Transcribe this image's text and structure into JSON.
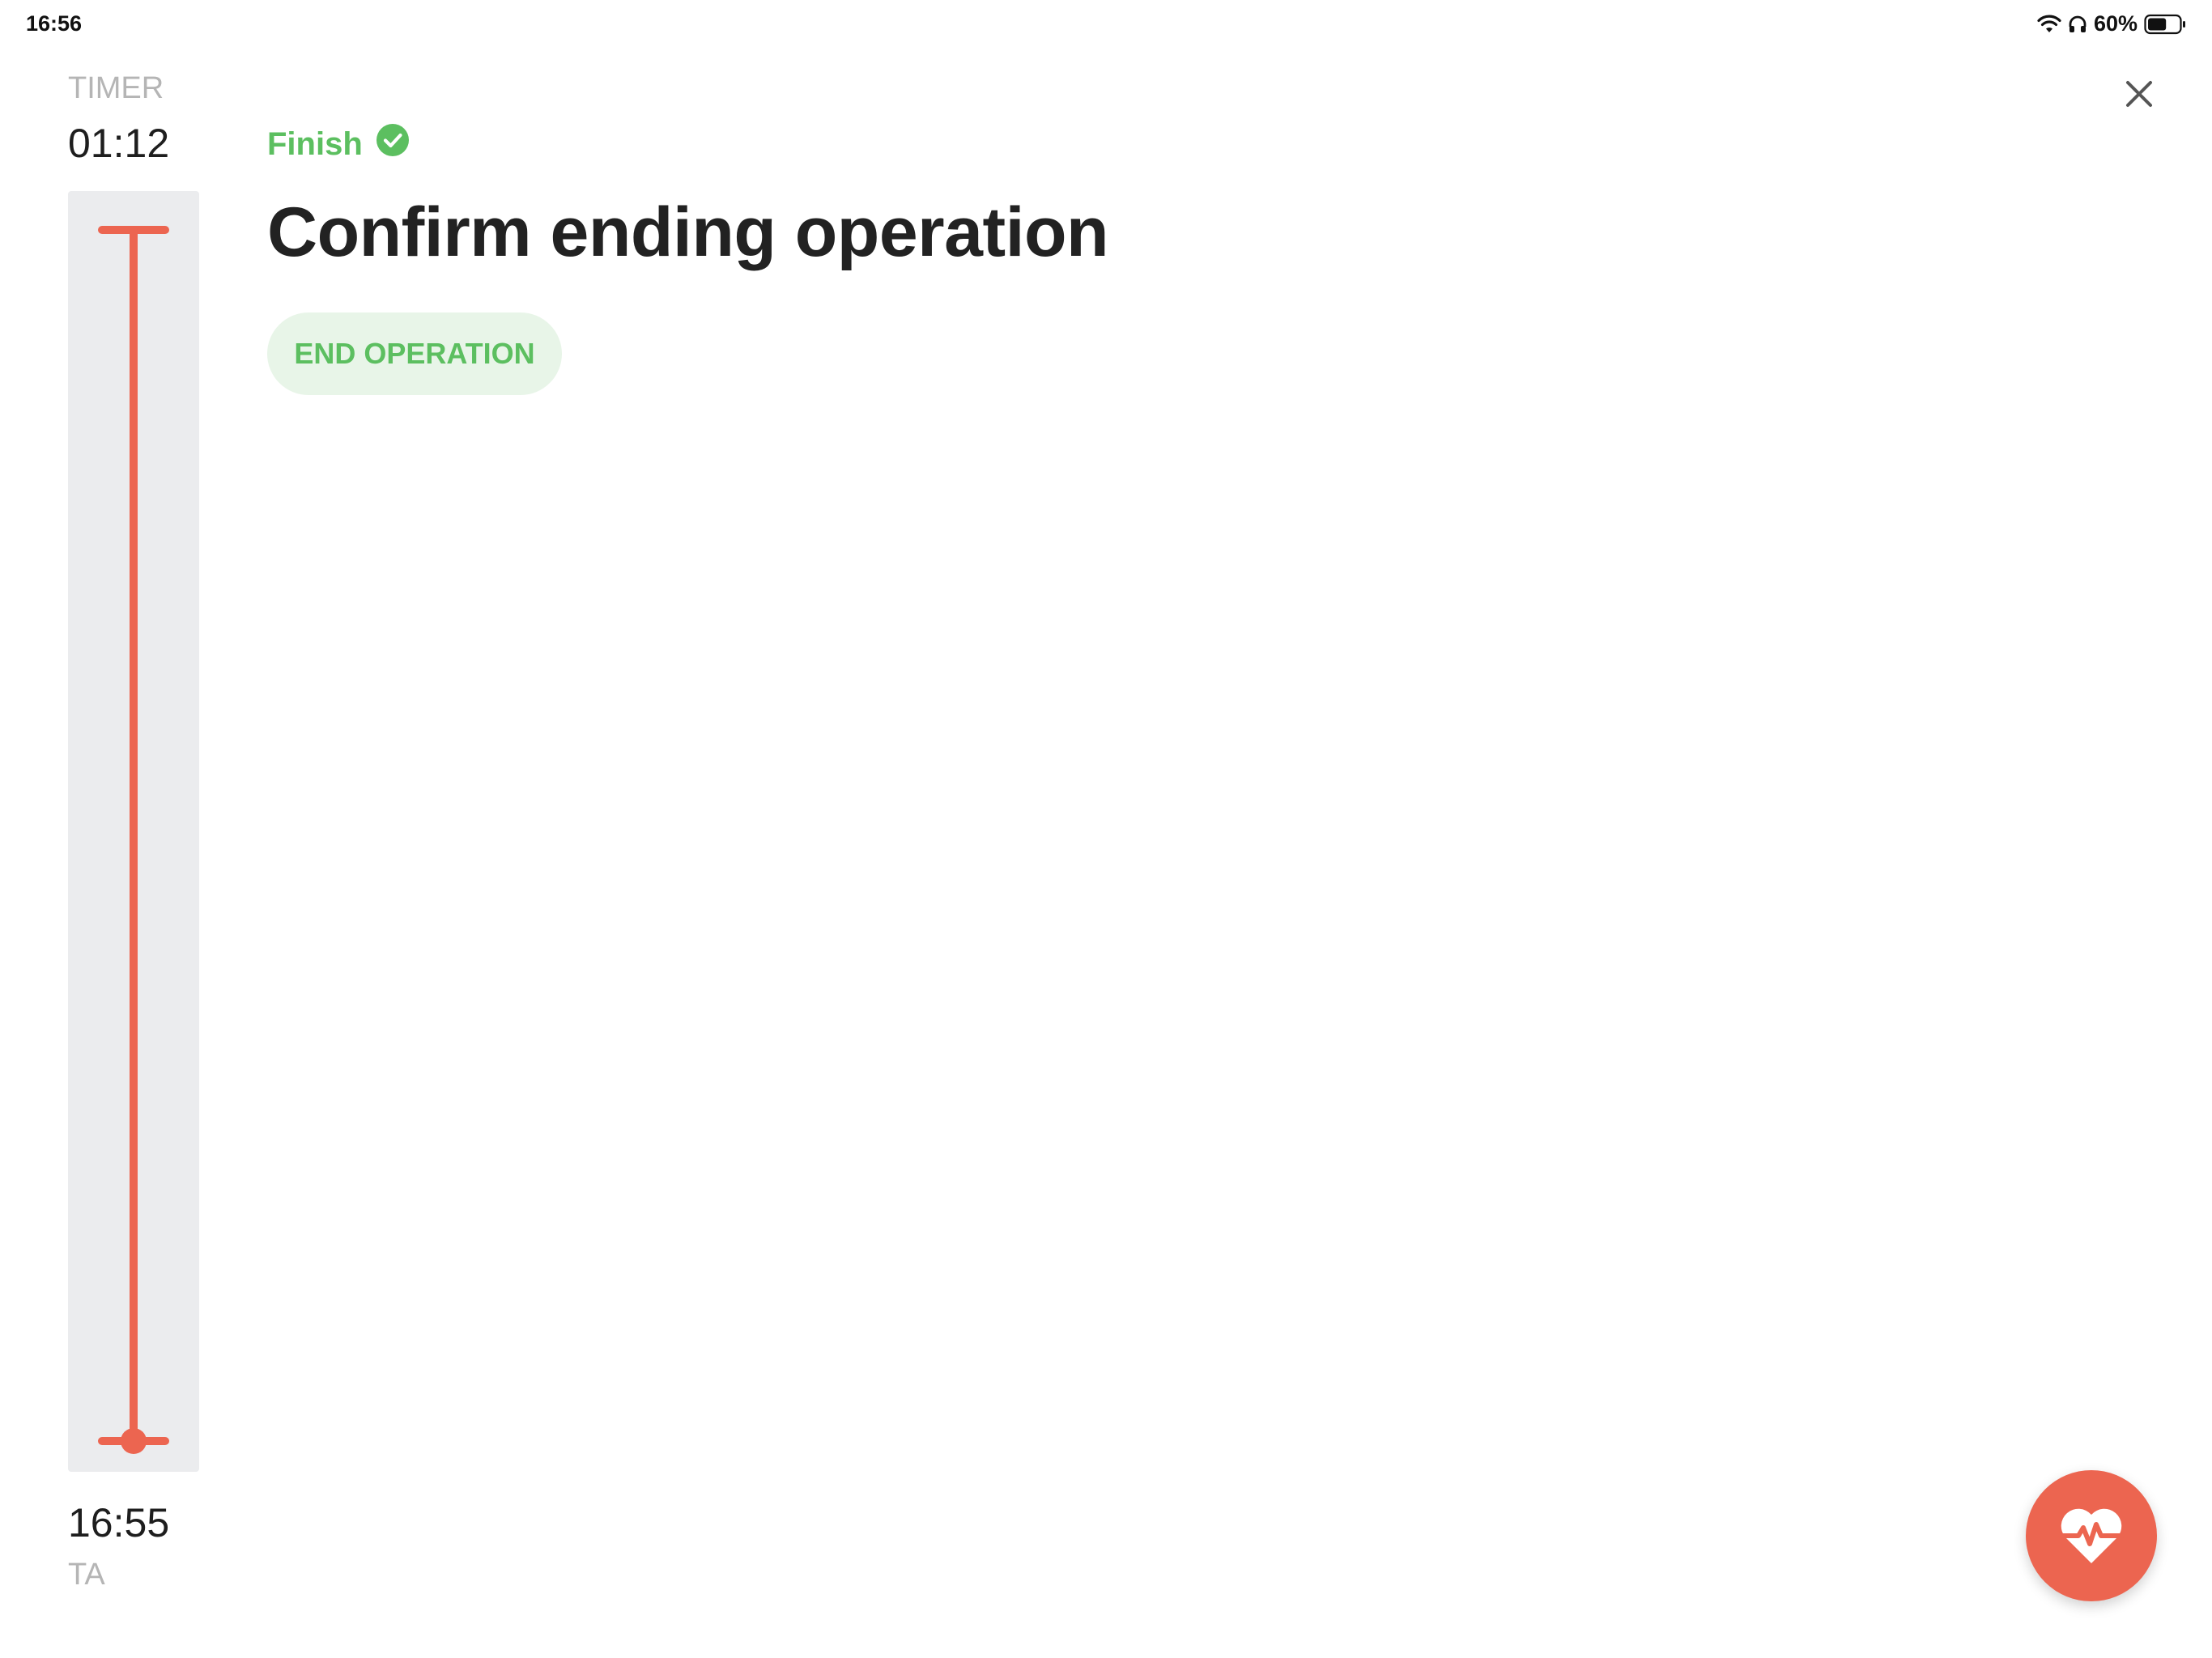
{
  "status_bar": {
    "time": "16:56",
    "battery_percent": "60%",
    "battery_level": 0.6,
    "icons": [
      "wifi-icon",
      "headphones-icon",
      "battery-icon"
    ]
  },
  "timer": {
    "label": "TIMER",
    "value": "01:12"
  },
  "timeline": {
    "start_time": "16:55",
    "start_label": "TA",
    "progress": 1.0
  },
  "main": {
    "status_label": "Finish",
    "status_icon": "check-circle-icon",
    "title": "Confirm ending operation",
    "end_button_label": "END OPERATION"
  },
  "actions": {
    "close_icon": "close-icon",
    "fab_icon": "heart-pulse-icon"
  },
  "colors": {
    "accent_green": "#5cbf60",
    "green_bg": "#e8f5e8",
    "timeline_red": "#ec6550",
    "fab_red": "#ec6550",
    "track_gray": "#ebecee",
    "muted_text": "#b5b5b5"
  }
}
